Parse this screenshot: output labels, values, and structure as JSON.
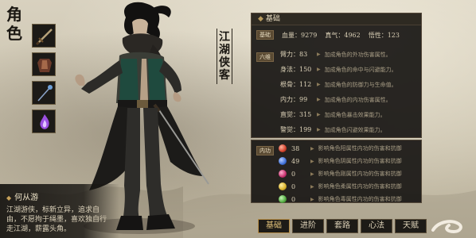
{
  "side_title": [
    "角",
    "色"
  ],
  "nickname": [
    "江",
    "湖",
    "侠",
    "客"
  ],
  "character": {
    "name": "何从游",
    "description": "江湖游侠，标新立异，追求自由，不愿拘于绳墨，喜欢独自行走江湖，薪露头角。"
  },
  "base_panel": {
    "title": "基础",
    "summary_tag": "基础",
    "blood_label": "血量：9279",
    "qi_label": "真气：4962",
    "wuxing_label": "悟性：123",
    "stats_tag": "六维",
    "stats": [
      {
        "label": "臂力：83",
        "desc": "加成角色的外功伤害属性。"
      },
      {
        "label": "身法：150",
        "desc": "加成角色的命中与闪避能力。"
      },
      {
        "label": "根骨：112",
        "desc": "加成角色的防御力与生命值。"
      },
      {
        "label": "内力：99",
        "desc": "加成角色的内功伤害属性。"
      },
      {
        "label": "直觉：315",
        "desc": "加成角色暴击效果能力。"
      },
      {
        "label": "警觉：199",
        "desc": "加成角色闪避效果能力。"
      }
    ]
  },
  "neigong_panel": {
    "tag": "内功",
    "rows": [
      {
        "value": "38",
        "color": "#d0412c",
        "desc": "影响角色阳属性内功的伤害和抗御"
      },
      {
        "value": "49",
        "color": "#3e6fd8",
        "desc": "影响角色阴属性内功的伤害和抗御"
      },
      {
        "value": "0",
        "color": "#c8326f",
        "desc": "影响角色刚属性内功的伤害和抗御"
      },
      {
        "value": "0",
        "color": "#d9b12a",
        "desc": "影响角色柔属性内功的伤害和抗御"
      },
      {
        "value": "0",
        "color": "#4fa83d",
        "desc": "影响角色毒属性内功的伤害和抗御"
      }
    ]
  },
  "tabs": [
    "基础",
    "进阶",
    "套路",
    "心法",
    "天赋"
  ],
  "active_tab": 0
}
